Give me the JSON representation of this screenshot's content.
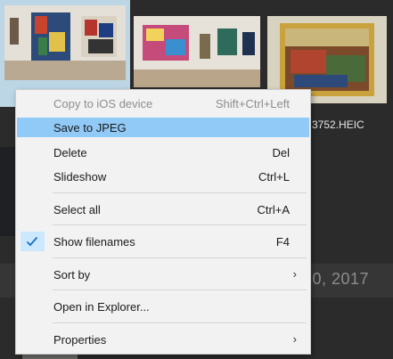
{
  "gallery": {
    "filename_fragment": "3752.HEIC",
    "date_fragment": "30, 2017"
  },
  "menu": {
    "items": [
      {
        "label": "Copy to iOS device",
        "shortcut": "Shift+Ctrl+Left",
        "disabled": true
      },
      {
        "label": "Save to JPEG",
        "shortcut": "",
        "highlighted": true
      },
      {
        "label": "Delete",
        "shortcut": "Del"
      },
      {
        "label": "Slideshow",
        "shortcut": "Ctrl+L"
      },
      {
        "label": "Select all",
        "shortcut": "Ctrl+A"
      },
      {
        "label": "Show filenames",
        "shortcut": "F4",
        "checked": true
      },
      {
        "label": "Sort by",
        "submenu": true
      },
      {
        "label": "Open in Explorer...",
        "shortcut": ""
      },
      {
        "label": "Properties",
        "submenu": true
      }
    ],
    "submenu_arrow": "›"
  },
  "colors": {
    "menu_background": "#f2f2f2",
    "highlight": "#91c9f7",
    "check_background": "#cce8ff",
    "check_mark": "#1a6fc2"
  },
  "icons": {
    "check": "checkmark-icon",
    "submenu": "chevron-right-icon"
  }
}
